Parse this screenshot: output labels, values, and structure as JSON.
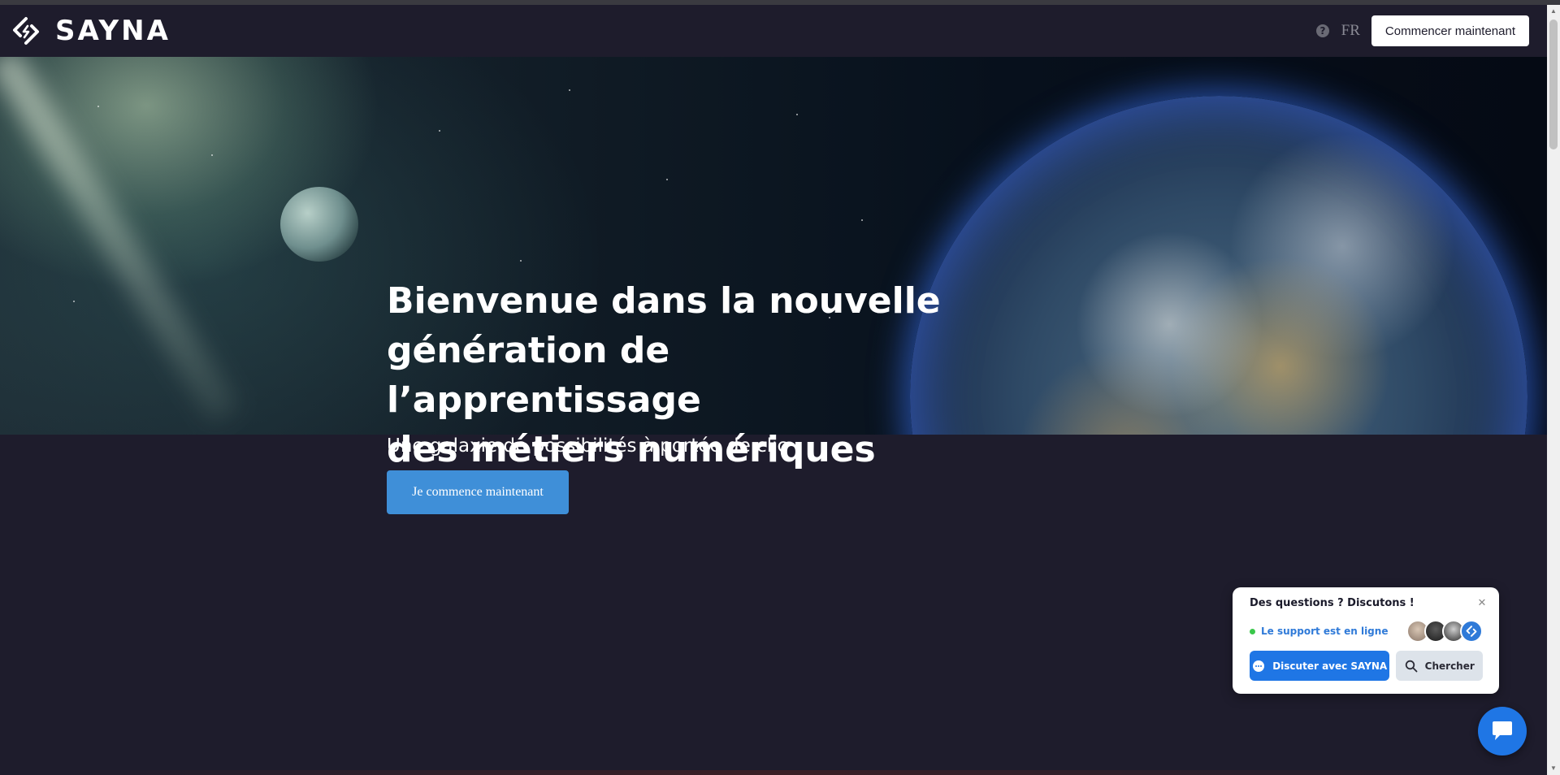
{
  "nav": {
    "brand": "SAYNA",
    "language": "FR",
    "cta_label": "Commencer maintenant"
  },
  "hero": {
    "title": "Bienvenue dans la nouvelle\ngénération de l’apprentissage\ndes métiers numériques",
    "subtitle": "Une galaxie de possibilités à portée de clic",
    "cta_label": "Je commence maintenant"
  },
  "chat_widget": {
    "title": "Des questions ? Discutons !",
    "status": "Le support est en ligne",
    "primary_button": "Discuter avec SAYNA",
    "secondary_button": "Chercher",
    "close_symbol": "✕"
  },
  "colors": {
    "background": "#1e1c2c",
    "primary_blue": "#1f76e5",
    "hero_button": "#3f8fd8",
    "online": "#3ac74b"
  },
  "icons": [
    "sayna-logo-icon",
    "help-icon",
    "close-icon",
    "chat-bubble-icon",
    "search-icon",
    "chat-launcher-icon"
  ]
}
